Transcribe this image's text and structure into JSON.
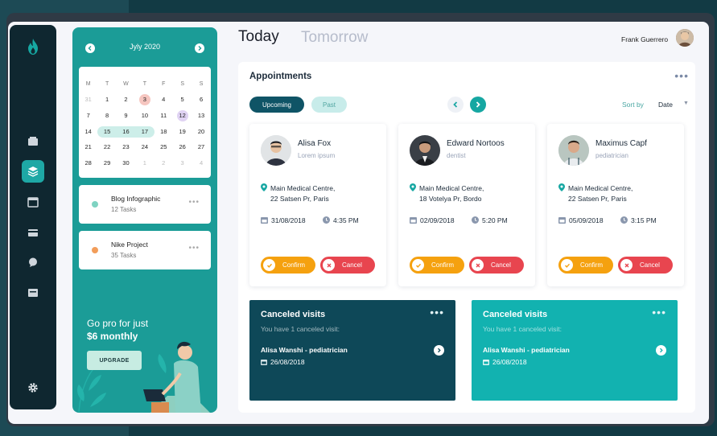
{
  "colors": {
    "accent": "#1b9c97",
    "dark_teal": "#0e4858",
    "confirm": "#f5a10f",
    "cancel": "#e8454f"
  },
  "sidebar": {
    "items": [
      {
        "name": "inbox-icon",
        "active": false
      },
      {
        "name": "layers-icon",
        "active": true
      },
      {
        "name": "calendar-icon",
        "active": false
      },
      {
        "name": "card-icon",
        "active": false
      },
      {
        "name": "chat-icon",
        "active": false
      },
      {
        "name": "archive-icon",
        "active": false
      }
    ],
    "settings": "gear-icon"
  },
  "calendar": {
    "month": "Jyly 2020",
    "weekdays": [
      "M",
      "T",
      "W",
      "T",
      "F",
      "S",
      "S"
    ],
    "weeks": [
      [
        "31",
        "1",
        "2",
        "3",
        "4",
        "5",
        "6"
      ],
      [
        "7",
        "8",
        "9",
        "10",
        "11",
        "12",
        "13"
      ],
      [
        "14",
        "15",
        "16",
        "17",
        "18",
        "19",
        "20"
      ],
      [
        "21",
        "22",
        "23",
        "24",
        "25",
        "26",
        "27"
      ],
      [
        "28",
        "29",
        "30",
        "1",
        "2",
        "3",
        "4"
      ]
    ]
  },
  "tasks": [
    {
      "title": "Blog Infographic",
      "count": "12 Tasks",
      "dot_color": "#7fd3c2"
    },
    {
      "title": "Nike Project",
      "count": "35 Tasks",
      "dot_color": "#f29d5a"
    }
  ],
  "promo": {
    "line1": "Go pro for just",
    "line2": "$6 monthly",
    "button": "UPGRADE"
  },
  "header": {
    "tab_today": "Today",
    "tab_tomorrow": "Tomorrow",
    "user_name": "Frank Guerrero"
  },
  "appointments": {
    "title": "Appointments",
    "filter_upcoming": "Upcoming",
    "filter_past": "Past",
    "sort_label": "Sort by",
    "sort_value": "Date",
    "cards": [
      {
        "name": "Alisa Fox",
        "specialty": "Lorem ipsum",
        "address1": "Main Medical Centre,",
        "address2": "22 Satsen Pr, Paris",
        "date": "31/08/2018",
        "time": "4:35 PM",
        "confirm": "Confirm",
        "cancel": "Cancel"
      },
      {
        "name": "Edward Nortoos",
        "specialty": "dentist",
        "address1": "Main Medical Centre,",
        "address2": "18 Votelya Pr, Bordo",
        "date": "02/09/2018",
        "time": "5:20 PM",
        "confirm": "Confirm",
        "cancel": "Cancel"
      },
      {
        "name": "Maximus Capf",
        "specialty": "pediatrician",
        "address1": "Main Medical Centre,",
        "address2": "22 Satsen Pr, Paris",
        "date": "05/09/2018",
        "time": "3:15 PM",
        "confirm": "Confirm",
        "cancel": "Cancel"
      }
    ]
  },
  "canceled": [
    {
      "title": "Canceled visits",
      "subtitle": "You have 1 canceled visit:",
      "name": "Alisa Wanshi - pediatrician",
      "date": "26/08/2018"
    },
    {
      "title": "Canceled visits",
      "subtitle": "You have 1 canceled visit:",
      "name": "Alisa Wanshi - pediatrician",
      "date": "26/08/2018"
    }
  ]
}
